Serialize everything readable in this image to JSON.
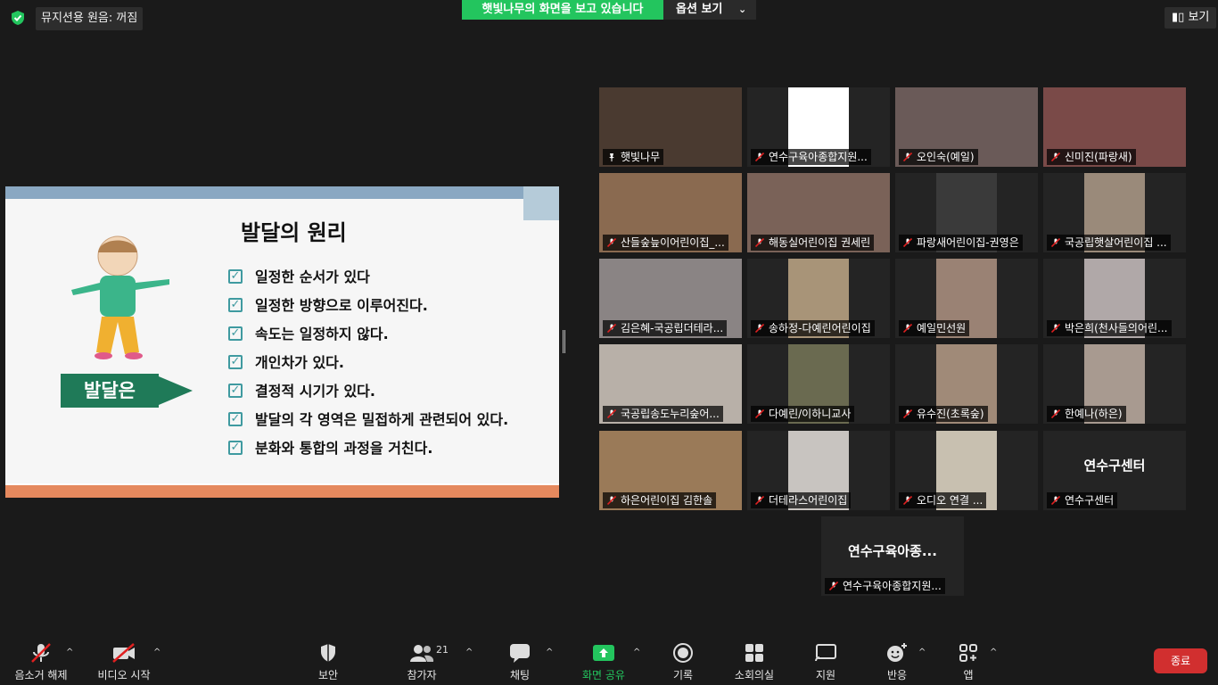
{
  "top": {
    "original_sound": "뮤지션용 원음: 꺼짐",
    "share_banner": "햇빛나무의 화면을 보고 있습니다",
    "view_options": "옵션 보기",
    "view_button": "보기"
  },
  "slide": {
    "title": "발달의 원리",
    "arrow_label": "발달은",
    "points": [
      "일정한 순서가 있다",
      "일정한 방향으로  이루어진다.",
      "속도는 일정하지 않다.",
      "개인차가 있다.",
      "결정적 시기가 있다.",
      "발달의 각 영역은 밀접하게 관련되어 있다.",
      "분화와 통합의 과정을 거친다."
    ]
  },
  "participants": [
    {
      "name": "햇빛나무",
      "video": "#4a3a30"
    },
    {
      "name": "연수구육아종합지원...",
      "video": "#ffffff"
    },
    {
      "name": "오인숙(예일)",
      "video": "#6a5a58"
    },
    {
      "name": "신미진(파랑새)",
      "video": "#7a4a48"
    },
    {
      "name": "산들숲늪이어린이집_...",
      "video": "#8a6a50"
    },
    {
      "name": "해동실어린이집 권세린",
      "video": "#7a6258"
    },
    {
      "name": "파랑새어린이집-권영은",
      "video": "#3a3a3a"
    },
    {
      "name": "국공립햇살어린이집 ...",
      "video": "#9a8a7a"
    },
    {
      "name": "김은혜-국공립더테라...",
      "video": "#8a8484"
    },
    {
      "name": "송하정-다예린어린이집",
      "video": "#a89478"
    },
    {
      "name": "예일민선원",
      "video": "#9a8274"
    },
    {
      "name": "박은희(천사들의어린...",
      "video": "#b0a8a8"
    },
    {
      "name": "국공립송도누리숲어...",
      "video": "#b8b0a8"
    },
    {
      "name": "다예린/이하니교사",
      "video": "#6a6a50"
    },
    {
      "name": "유수진(초록숲)",
      "video": "#a08a78"
    },
    {
      "name": "한예나(하은)",
      "video": "#a89a90"
    },
    {
      "name": "하은어린이집 김한솔",
      "video": "#9a7a58"
    },
    {
      "name": "더테라스어린이집",
      "video": "#c8c4c0"
    },
    {
      "name": "오디오 연결 ...",
      "video": "#c8c0b0"
    },
    {
      "name": "연수구센터",
      "display": "연수구센터"
    },
    {
      "name": "연수구육아종합지원...",
      "display": "연수구육아종...",
      "video": ""
    }
  ],
  "toolbar": {
    "mute": "음소거 해제",
    "video": "비디오 시작",
    "security": "보안",
    "participants": "참가자",
    "participant_count": "21",
    "chat": "채팅",
    "share": "화면 공유",
    "record": "기록",
    "breakout": "소회의실",
    "support": "지원",
    "reactions": "반응",
    "apps": "앱",
    "end": "종료"
  }
}
